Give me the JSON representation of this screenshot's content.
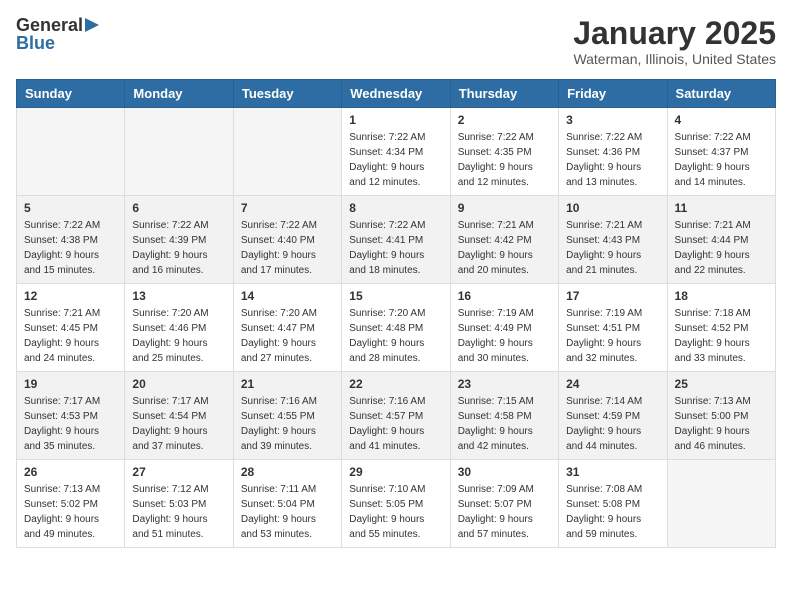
{
  "header": {
    "logo_general": "General",
    "logo_blue": "Blue",
    "month_title": "January 2025",
    "location": "Waterman, Illinois, United States"
  },
  "weekdays": [
    "Sunday",
    "Monday",
    "Tuesday",
    "Wednesday",
    "Thursday",
    "Friday",
    "Saturday"
  ],
  "weeks": [
    [
      {
        "day": "",
        "info": ""
      },
      {
        "day": "",
        "info": ""
      },
      {
        "day": "",
        "info": ""
      },
      {
        "day": "1",
        "info": "Sunrise: 7:22 AM\nSunset: 4:34 PM\nDaylight: 9 hours\nand 12 minutes."
      },
      {
        "day": "2",
        "info": "Sunrise: 7:22 AM\nSunset: 4:35 PM\nDaylight: 9 hours\nand 12 minutes."
      },
      {
        "day": "3",
        "info": "Sunrise: 7:22 AM\nSunset: 4:36 PM\nDaylight: 9 hours\nand 13 minutes."
      },
      {
        "day": "4",
        "info": "Sunrise: 7:22 AM\nSunset: 4:37 PM\nDaylight: 9 hours\nand 14 minutes."
      }
    ],
    [
      {
        "day": "5",
        "info": "Sunrise: 7:22 AM\nSunset: 4:38 PM\nDaylight: 9 hours\nand 15 minutes."
      },
      {
        "day": "6",
        "info": "Sunrise: 7:22 AM\nSunset: 4:39 PM\nDaylight: 9 hours\nand 16 minutes."
      },
      {
        "day": "7",
        "info": "Sunrise: 7:22 AM\nSunset: 4:40 PM\nDaylight: 9 hours\nand 17 minutes."
      },
      {
        "day": "8",
        "info": "Sunrise: 7:22 AM\nSunset: 4:41 PM\nDaylight: 9 hours\nand 18 minutes."
      },
      {
        "day": "9",
        "info": "Sunrise: 7:21 AM\nSunset: 4:42 PM\nDaylight: 9 hours\nand 20 minutes."
      },
      {
        "day": "10",
        "info": "Sunrise: 7:21 AM\nSunset: 4:43 PM\nDaylight: 9 hours\nand 21 minutes."
      },
      {
        "day": "11",
        "info": "Sunrise: 7:21 AM\nSunset: 4:44 PM\nDaylight: 9 hours\nand 22 minutes."
      }
    ],
    [
      {
        "day": "12",
        "info": "Sunrise: 7:21 AM\nSunset: 4:45 PM\nDaylight: 9 hours\nand 24 minutes."
      },
      {
        "day": "13",
        "info": "Sunrise: 7:20 AM\nSunset: 4:46 PM\nDaylight: 9 hours\nand 25 minutes."
      },
      {
        "day": "14",
        "info": "Sunrise: 7:20 AM\nSunset: 4:47 PM\nDaylight: 9 hours\nand 27 minutes."
      },
      {
        "day": "15",
        "info": "Sunrise: 7:20 AM\nSunset: 4:48 PM\nDaylight: 9 hours\nand 28 minutes."
      },
      {
        "day": "16",
        "info": "Sunrise: 7:19 AM\nSunset: 4:49 PM\nDaylight: 9 hours\nand 30 minutes."
      },
      {
        "day": "17",
        "info": "Sunrise: 7:19 AM\nSunset: 4:51 PM\nDaylight: 9 hours\nand 32 minutes."
      },
      {
        "day": "18",
        "info": "Sunrise: 7:18 AM\nSunset: 4:52 PM\nDaylight: 9 hours\nand 33 minutes."
      }
    ],
    [
      {
        "day": "19",
        "info": "Sunrise: 7:17 AM\nSunset: 4:53 PM\nDaylight: 9 hours\nand 35 minutes."
      },
      {
        "day": "20",
        "info": "Sunrise: 7:17 AM\nSunset: 4:54 PM\nDaylight: 9 hours\nand 37 minutes."
      },
      {
        "day": "21",
        "info": "Sunrise: 7:16 AM\nSunset: 4:55 PM\nDaylight: 9 hours\nand 39 minutes."
      },
      {
        "day": "22",
        "info": "Sunrise: 7:16 AM\nSunset: 4:57 PM\nDaylight: 9 hours\nand 41 minutes."
      },
      {
        "day": "23",
        "info": "Sunrise: 7:15 AM\nSunset: 4:58 PM\nDaylight: 9 hours\nand 42 minutes."
      },
      {
        "day": "24",
        "info": "Sunrise: 7:14 AM\nSunset: 4:59 PM\nDaylight: 9 hours\nand 44 minutes."
      },
      {
        "day": "25",
        "info": "Sunrise: 7:13 AM\nSunset: 5:00 PM\nDaylight: 9 hours\nand 46 minutes."
      }
    ],
    [
      {
        "day": "26",
        "info": "Sunrise: 7:13 AM\nSunset: 5:02 PM\nDaylight: 9 hours\nand 49 minutes."
      },
      {
        "day": "27",
        "info": "Sunrise: 7:12 AM\nSunset: 5:03 PM\nDaylight: 9 hours\nand 51 minutes."
      },
      {
        "day": "28",
        "info": "Sunrise: 7:11 AM\nSunset: 5:04 PM\nDaylight: 9 hours\nand 53 minutes."
      },
      {
        "day": "29",
        "info": "Sunrise: 7:10 AM\nSunset: 5:05 PM\nDaylight: 9 hours\nand 55 minutes."
      },
      {
        "day": "30",
        "info": "Sunrise: 7:09 AM\nSunset: 5:07 PM\nDaylight: 9 hours\nand 57 minutes."
      },
      {
        "day": "31",
        "info": "Sunrise: 7:08 AM\nSunset: 5:08 PM\nDaylight: 9 hours\nand 59 minutes."
      },
      {
        "day": "",
        "info": ""
      }
    ]
  ]
}
